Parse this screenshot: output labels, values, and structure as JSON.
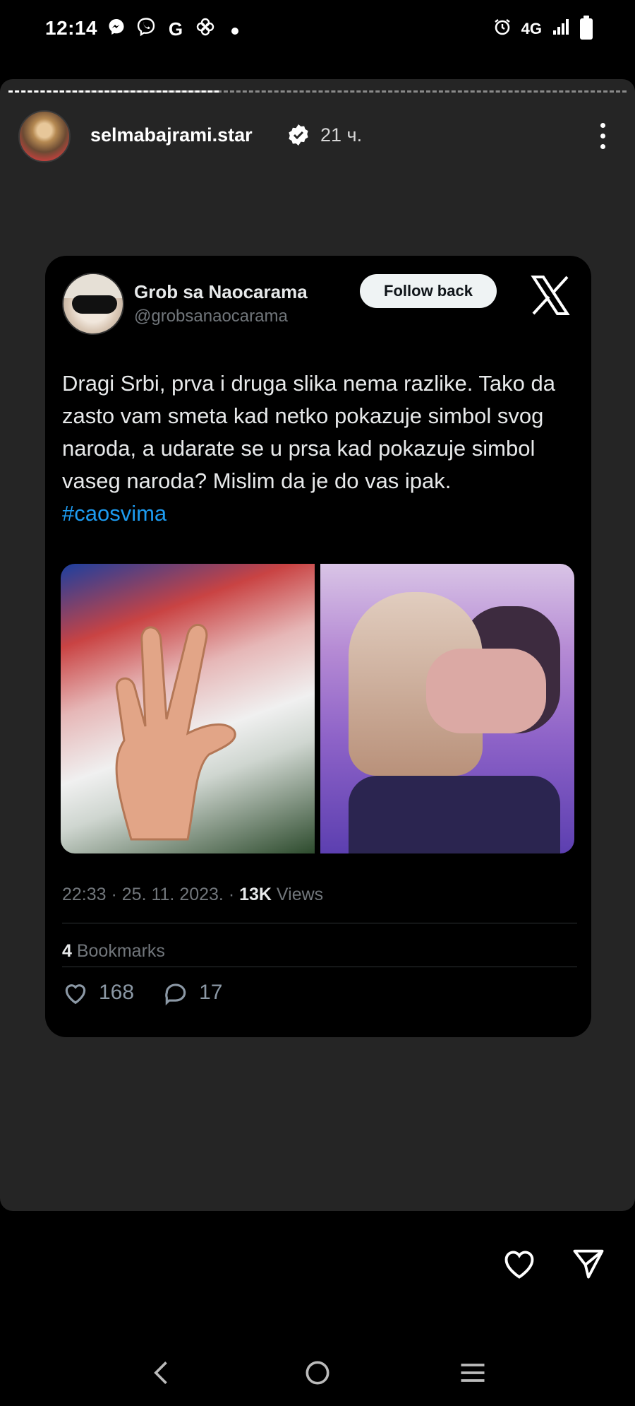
{
  "status_bar": {
    "time": "12:14",
    "left_icons": [
      "messenger-icon",
      "viber-icon",
      "google-icon",
      "pinwheel-icon",
      "dot-icon"
    ],
    "google_glyph": "G",
    "network": "4G",
    "right_icons": [
      "alarm-icon",
      "signal-icon",
      "battery-icon"
    ]
  },
  "story": {
    "username": "selmabajrami.star",
    "time_ago": "21 ч.",
    "verified": true,
    "progress": 0.34
  },
  "tweet": {
    "author_name": "Grob sa Naocarama",
    "author_handle": "@grobsanaocarama",
    "follow_label": "Follow back",
    "text": "Dragi Srbi, prva i druga slika nema razlike. Tako da zasto vam smeta kad netko pokazuje simbol svog naroda, a udarate se u prsa kad pokazuje simbol vaseg naroda? Mislim da je do vas ipak.",
    "hashtag": "#caosvima",
    "timestamp": "22:33 · 25. 11. 2023. · ",
    "views_count": "13K",
    "views_label": " Views",
    "bookmarks_count": "4",
    "bookmarks_label": " Bookmarks",
    "likes": "168",
    "replies": "17"
  },
  "colors": {
    "story_background": "#252525",
    "tweet_background": "#000000",
    "hashtag": "#1d9bf0",
    "muted_text": "#71767b"
  }
}
